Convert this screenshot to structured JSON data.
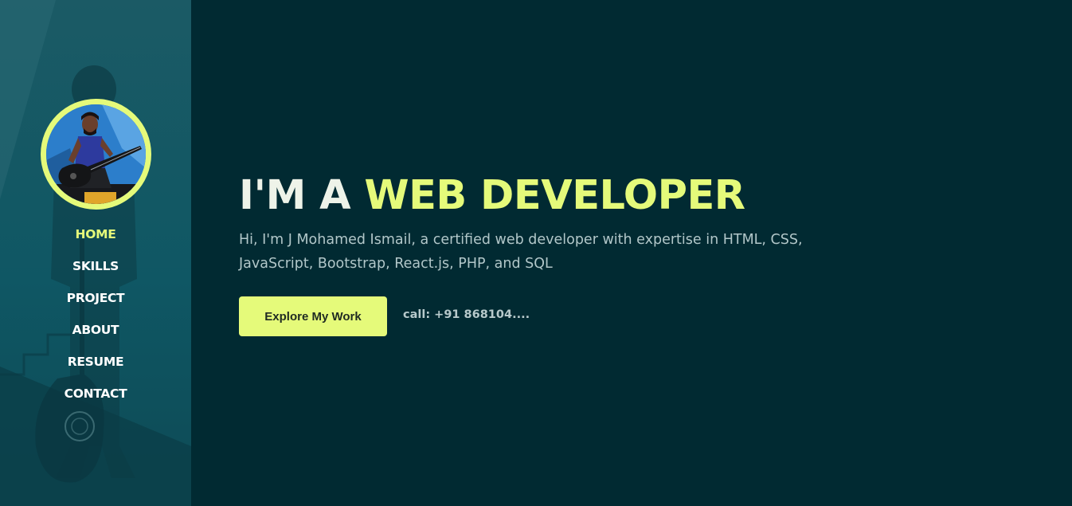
{
  "sidebar": {
    "nav": [
      {
        "label": "HOME",
        "active": true
      },
      {
        "label": "SKILLS",
        "active": false
      },
      {
        "label": "PROJECT",
        "active": false
      },
      {
        "label": "ABOUT",
        "active": false
      },
      {
        "label": "RESUME",
        "active": false
      },
      {
        "label": "CONTACT",
        "active": false
      }
    ]
  },
  "hero": {
    "headline_prefix": "I'M A ",
    "headline_accent": "WEB DEVELOPER",
    "intro": "Hi, I'm J Mohamed Ismail, a certified web developer with expertise in HTML, CSS, JavaScript, Bootstrap, React.js, PHP, and SQL",
    "cta_label": "Explore My Work",
    "call_text": "call: +91 868104...."
  },
  "colors": {
    "background": "#012a32",
    "sidebar": "#134f5a",
    "accent": "#e5fa7a",
    "text_primary": "#eef3e9",
    "text_muted": "#b2c7c9"
  },
  "icons": {
    "avatar": "profile-photo-guitar"
  }
}
